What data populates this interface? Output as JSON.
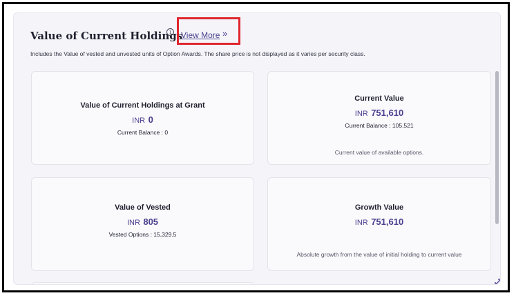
{
  "header": {
    "title": "Value of Current Holdings",
    "info_icon": "info-icon",
    "info_glyph": "i",
    "view_more_label": "View More",
    "view_more_chevron": "»",
    "description": "Includes the Value of vested and unvested units of Option Awards. The share price is not displayed as it varies per security class."
  },
  "cards": [
    {
      "title": "Value of Current Holdings at Grant",
      "currency": "INR",
      "value": "0",
      "subtext": "Current Balance : 0",
      "note": ""
    },
    {
      "title": "Current Value",
      "currency": "INR",
      "value": "751,610",
      "subtext": "Current Balance : 105,521",
      "note": "Current value of available options."
    },
    {
      "title": "Value of Vested",
      "currency": "INR",
      "value": "805",
      "subtext": "Vested Options : 15,329.5",
      "note": ""
    },
    {
      "title": "Growth Value",
      "currency": "INR",
      "value": "751,610",
      "subtext": "",
      "note": "Absolute growth from the value of initial holding to current value"
    }
  ],
  "colors": {
    "accent": "#4a3f8f",
    "highlight": "#e0262e",
    "panel_bg": "#f5f5f9",
    "card_bg": "#fafafc"
  },
  "icons": {
    "expand": "expand-icon"
  }
}
